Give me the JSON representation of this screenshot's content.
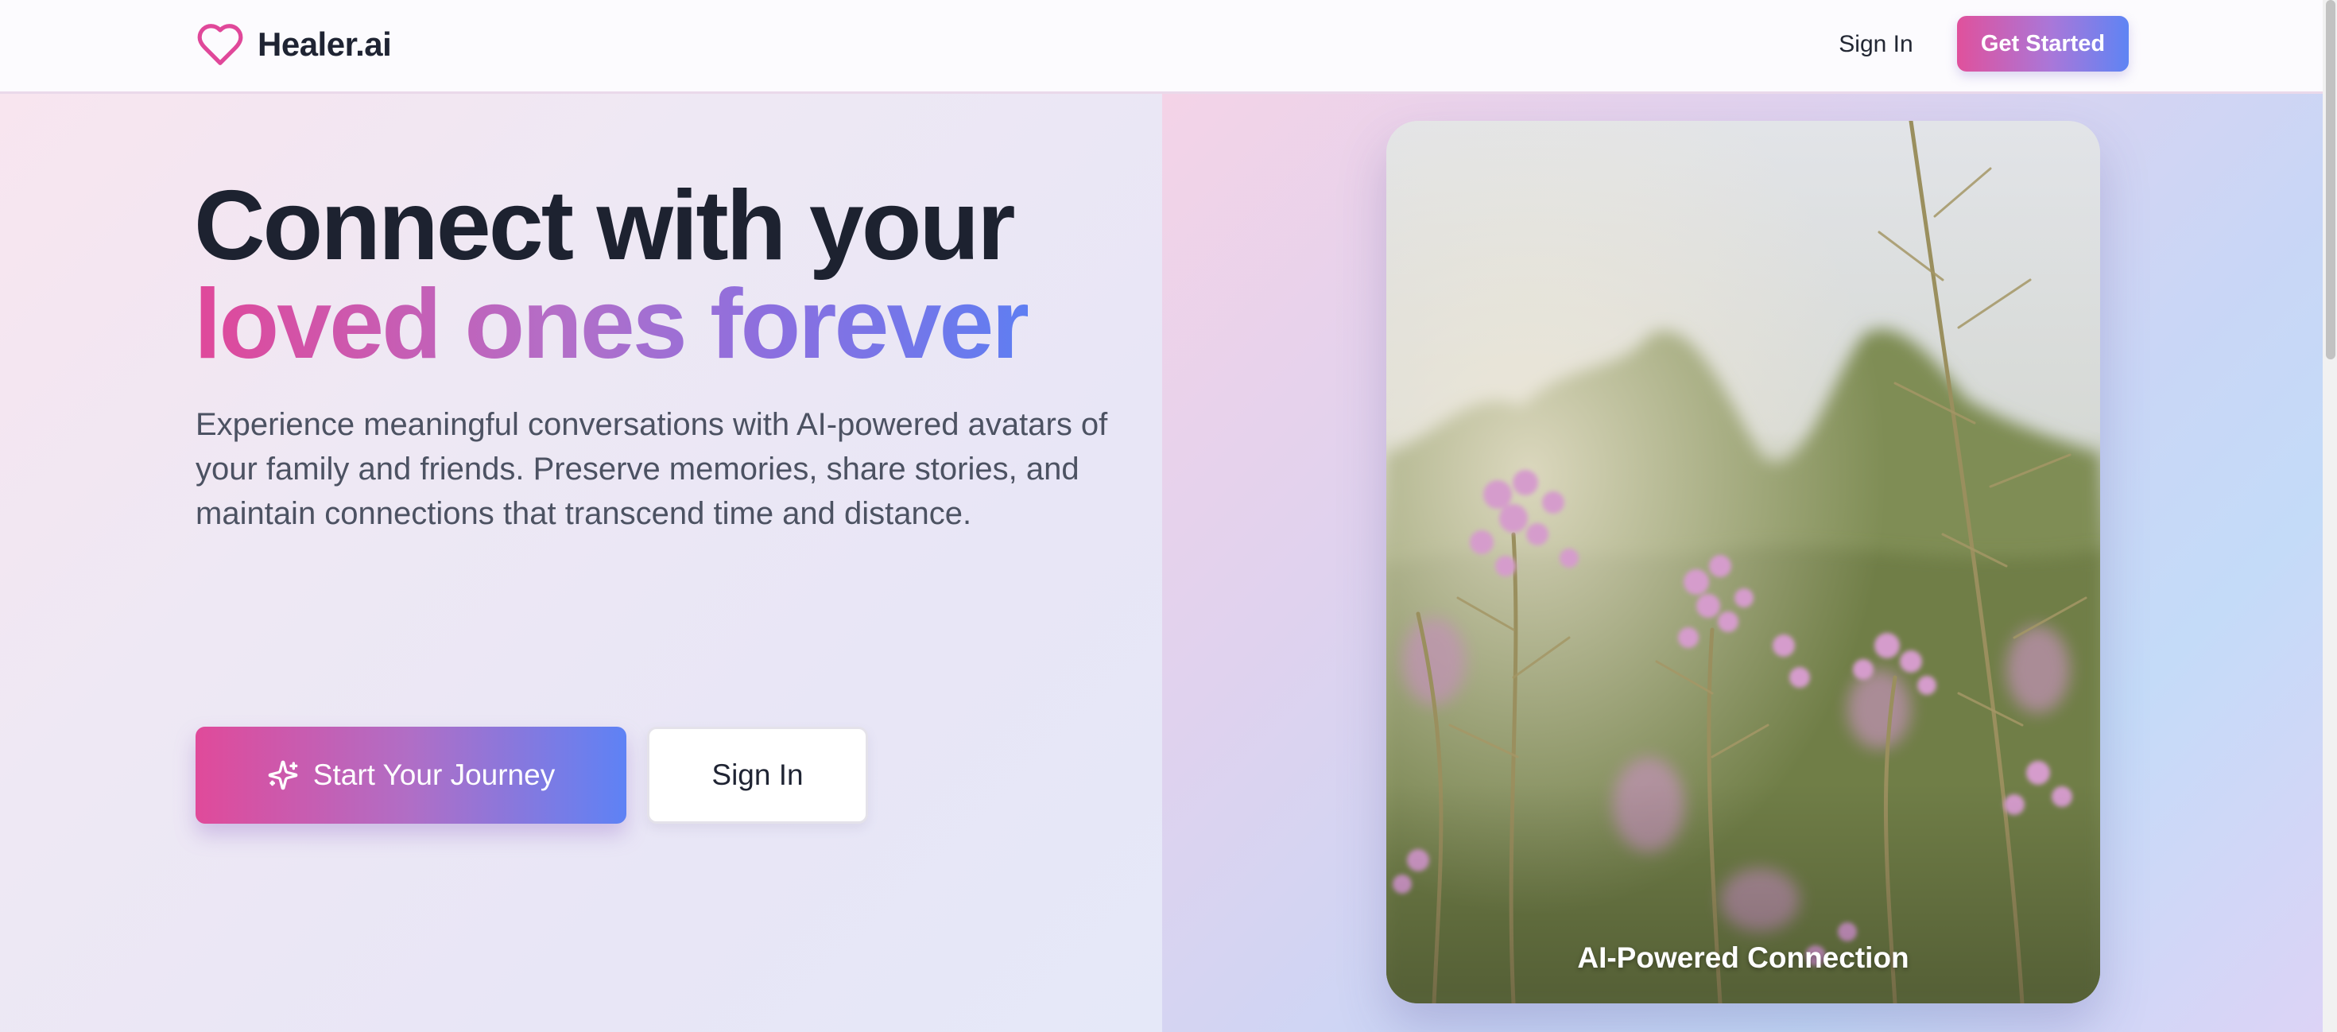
{
  "header": {
    "brand_name": "Healer.ai",
    "logo_icon": "heart-icon",
    "sign_in_label": "Sign In",
    "get_started_label": "Get Started"
  },
  "hero": {
    "headline_line1": "Connect with your",
    "headline_line2": "loved ones forever",
    "description": "Experience meaningful conversations with AI-powered avatars of your family and friends. Preserve memories, share stories, and maintain connections that transcend time and distance.",
    "primary_cta_label": "Start Your Journey",
    "primary_cta_icon": "sparkle-icon",
    "secondary_cta_label": "Sign In",
    "image_caption": "AI-Powered Connection"
  },
  "colors": {
    "brand_pink": "#e0519c",
    "brand_blue": "#5e84f4",
    "heading_dark": "#1d2230",
    "body_text": "#4c5262"
  }
}
